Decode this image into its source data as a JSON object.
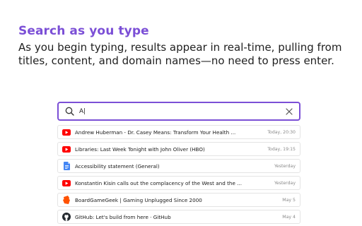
{
  "heading": "Search as you type",
  "description": "As you begin typing, results appear in real-time, pulling from titles, content, and domain names—no need to press enter.",
  "search": {
    "value": "A|",
    "icon": "search-icon",
    "clear_icon": "close-icon"
  },
  "colors": {
    "accent": "#7b4fd6",
    "youtube": "#ff0000",
    "docs": "#4285f4",
    "bgg": "#ff5100",
    "github": "#24292f"
  },
  "results": [
    {
      "icon": "youtube-icon",
      "title": "Andrew Huberman - Dr. Casey Means: Transform Your Health ...",
      "time": "Today, 20:30"
    },
    {
      "icon": "youtube-icon",
      "title": "Libraries: Last Week Tonight with John Oliver (HBO)",
      "time": "Today, 19:15"
    },
    {
      "icon": "google-docs-icon",
      "title": "Accessibility statement (General)",
      "time": "Yesterday"
    },
    {
      "icon": "youtube-icon",
      "title": "Konstantin Kisin calls out the complacency of the West and the ...",
      "time": "Yesterday"
    },
    {
      "icon": "boardgamegeek-icon",
      "title": "BoardGameGeek | Gaming Unplugged Since 2000",
      "time": "May 5"
    },
    {
      "icon": "github-icon",
      "title": "GitHub: Let's build from here · GitHub",
      "time": "May 4"
    }
  ]
}
